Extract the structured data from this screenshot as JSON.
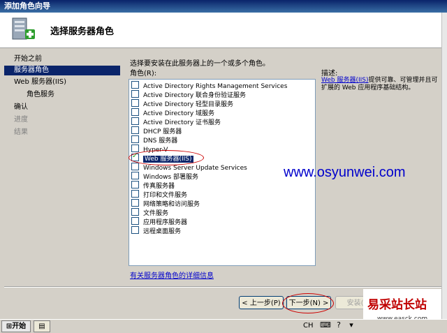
{
  "window": {
    "title": "添加角色向导"
  },
  "header": {
    "title": "选择服务器角色"
  },
  "nav": [
    {
      "label": "开始之前",
      "state": "normal"
    },
    {
      "label": "服务器角色",
      "state": "active"
    },
    {
      "label": "Web 服务器(IIS)",
      "state": "normal"
    },
    {
      "label": "角色服务",
      "state": "sub"
    },
    {
      "label": "确认",
      "state": "normal"
    },
    {
      "label": "进度",
      "state": "dim"
    },
    {
      "label": "结果",
      "state": "dim"
    }
  ],
  "main": {
    "instruction": "选择要安装在此服务器上的一个或多个角色。",
    "roles_label": "角色(R):",
    "roles": [
      {
        "label": "Active Directory Rights Management Services",
        "checked": false
      },
      {
        "label": "Active Directory 联合身份验证服务",
        "checked": false
      },
      {
        "label": "Active Directory 轻型目录服务",
        "checked": false
      },
      {
        "label": "Active Directory 域服务",
        "checked": false
      },
      {
        "label": "Active Directory 证书服务",
        "checked": false
      },
      {
        "label": "DHCP 服务器",
        "checked": false
      },
      {
        "label": "DNS 服务器",
        "checked": false
      },
      {
        "label": "Hyper-V",
        "checked": false
      },
      {
        "label": "Web 服务器(IIS)",
        "checked": true
      },
      {
        "label": "Windows Server Update Services",
        "checked": false
      },
      {
        "label": "Windows 部署服务",
        "checked": false
      },
      {
        "label": "传真服务器",
        "checked": false
      },
      {
        "label": "打印和文件服务",
        "checked": false
      },
      {
        "label": "网络策略和访问服务",
        "checked": false
      },
      {
        "label": "文件服务",
        "checked": false
      },
      {
        "label": "应用程序服务器",
        "checked": false
      },
      {
        "label": "远程桌面服务",
        "checked": false
      }
    ],
    "more_info_link": "有关服务器角色的详细信息",
    "description_label": "描述:",
    "description_link": "Web 服务器(IIS)",
    "description_text": "提供可靠、可管理并且可扩展的 Web 应用程序基础结构。",
    "watermark": "www.osyunwei.com"
  },
  "buttons": {
    "prev": "< 上一步(P)",
    "next": "下一步(N) >",
    "install": "安装(I)"
  },
  "watermark2": {
    "main": "易采站长站",
    "url": "www.easck.com"
  },
  "taskbar": {
    "start": "开始",
    "lang": "CH"
  },
  "colors": {
    "titlebar": "#0a246a",
    "selection": "#0a246a",
    "link": "#0000cc",
    "annotation": "#cc0000"
  }
}
